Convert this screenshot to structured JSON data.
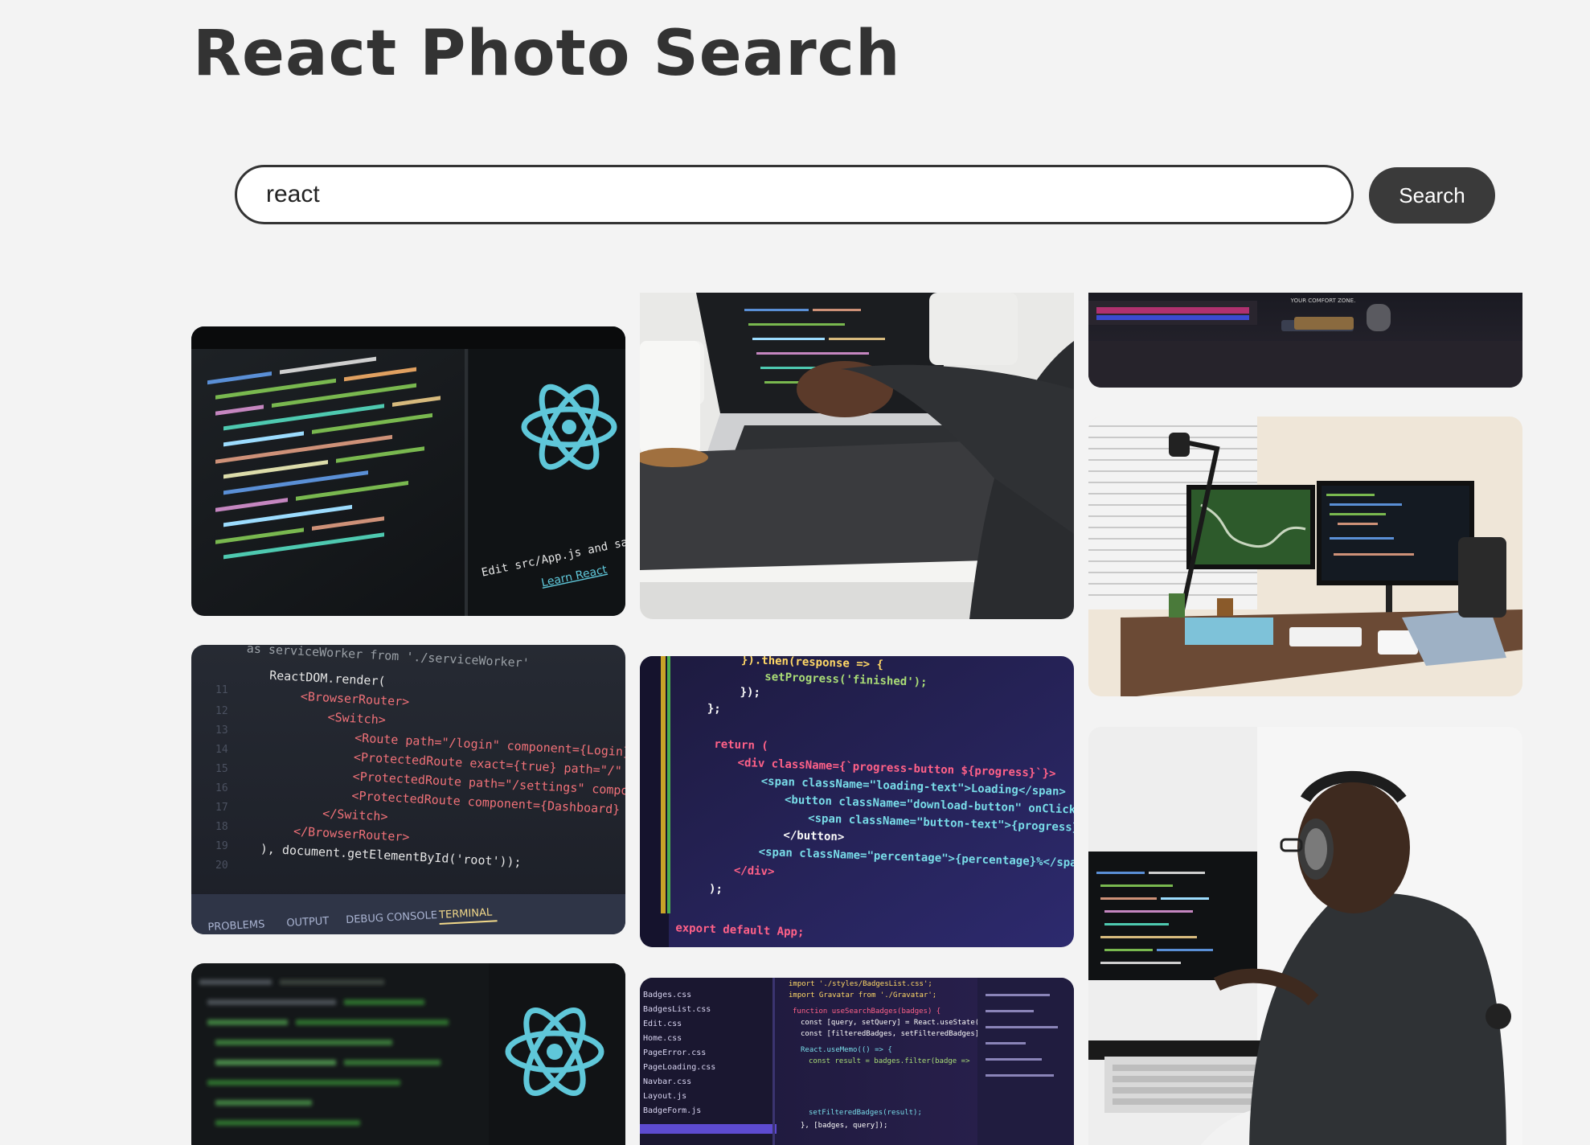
{
  "app": {
    "title": "React Photo Search"
  },
  "search": {
    "value": "react",
    "button_label": "Search"
  },
  "photos": [
    {
      "name": "react-logo-editor-photo",
      "texts": {
        "edit": "Edit src/App.js and save to reload.",
        "learn": "Learn React"
      }
    },
    {
      "name": "laptop-typing-photo"
    },
    {
      "name": "desk-setup-partial-photo",
      "texts": {
        "sign": "YOUR COMFORT ZONE."
      }
    },
    {
      "name": "react-router-code-photo",
      "texts": {
        "line1": "as serviceWorker from './serviceWorker'",
        "line2": "ReactDOM.render(",
        "line3": "<BrowserRouter>",
        "line4": "<Switch>",
        "line5": "<Route path=\"/login\" component={Login} />",
        "line6": "<ProtectedRoute exact={true} path=\"/\" component",
        "line7": "<ProtectedRoute path=\"/settings\" component",
        "line8": "<ProtectedRoute component={Dashboard} />",
        "line9": "</Switch>",
        "line10": "</BrowserRouter>",
        "line11": "), document.getElementById('root'));",
        "tab1": "PROBLEMS",
        "tab2": "OUTPUT",
        "tab3": "DEBUG CONSOLE",
        "tab4": "TERMINAL"
      }
    },
    {
      "name": "dual-monitor-desk-photo"
    },
    {
      "name": "progress-button-code-photo",
      "texts": {
        "line1": "}).then(response => {",
        "line2": "setProgress('finished');",
        "line3": "});",
        "line4": "};",
        "line5": "return (",
        "line6": "<div className={`progress-button ${progress}`}>",
        "line7": "<span className=\"loading-text\">Loading</span>",
        "line8": "<button className=\"download-button\" onClick={download}>",
        "line9": "<span className=\"button-text\">{progress}</span>",
        "line10": "</button>",
        "line11": "<span className=\"percentage\">{percentage}%</span>",
        "line12": "</div>",
        "line13": ");",
        "line14": "export default App;"
      }
    },
    {
      "name": "react-logo-blur-photo"
    },
    {
      "name": "headphones-developer-photo"
    },
    {
      "name": "badges-code-editor-photo",
      "texts": {
        "line1": "import './styles/BadgesList.css';",
        "line2": "import Gravatar from './Gravatar';",
        "line3": "function useSearchBadges(badges) {",
        "line4": "const [query, setQuery] = React.useState('');",
        "line5": "const [filteredBadges, setFilteredBadges]",
        "line6": "React.useMemo(() => {",
        "line7": "const result = badges.filter(badge =>",
        "line8": "setFilteredBadges(result);",
        "line9": "}, [badges, query]);",
        "file1": "Badges.css",
        "file2": "BadgesList.css",
        "file3": "Edit.css",
        "file4": "Home.css",
        "file5": "PageError.css",
        "file6": "PageLoading.css",
        "file7": "Navbar.css",
        "file8": "Layout.js",
        "file9": "BadgeForm.js"
      }
    }
  ]
}
